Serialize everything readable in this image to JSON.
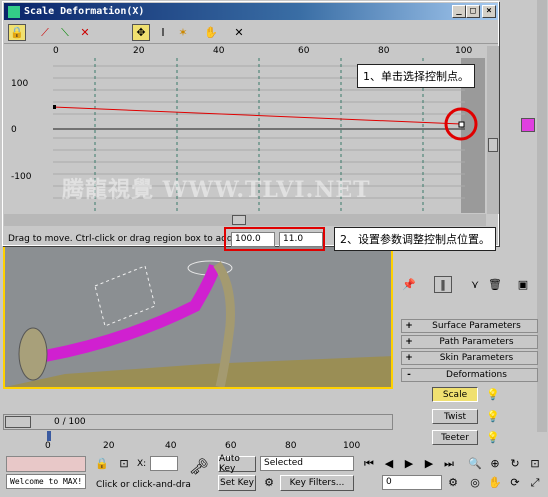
{
  "window": {
    "title": "Scale Deformation(X)"
  },
  "toolbar": {
    "icons": [
      "lock-icon",
      "curve-icon",
      "curve-icon",
      "curve-icon",
      "move-icon",
      "scale-icon",
      "insert-icon",
      "hand-icon",
      "delete-icon"
    ]
  },
  "ruler": {
    "ticks": [
      "0",
      "20",
      "40",
      "60",
      "80",
      "100"
    ]
  },
  "yaxis": {
    "ticks": [
      "100",
      "0",
      "-100"
    ]
  },
  "status": {
    "hint": "Drag to move. Ctrl-click or drag region box to add to",
    "x_value": "100.0",
    "y_value": "11.0"
  },
  "callouts": {
    "c1": "1、单击选择控制点。",
    "c2": "2、设置参数调整控制点位置。"
  },
  "watermark": "腾龍視覺 WWW.TLVI.NET",
  "rollouts": [
    {
      "sign": "+",
      "label": "Surface Parameters"
    },
    {
      "sign": "+",
      "label": "Path Parameters"
    },
    {
      "sign": "+",
      "label": "Skin Parameters"
    },
    {
      "sign": "-",
      "label": "Deformations"
    }
  ],
  "deform_buttons": [
    "Scale",
    "Twist",
    "Teeter"
  ],
  "timeline": {
    "frame": "0 / 100",
    "ticks": [
      "0",
      "20",
      "40",
      "60",
      "80",
      "100"
    ]
  },
  "bottom": {
    "maxscript": "Welcome to MAX!",
    "prompt": "Click or click-and-dra",
    "x_label": "X:",
    "autokey": "Auto Key",
    "setkey": "Set Key",
    "selected": "Selected",
    "keyfilters": "Key Filters...",
    "frame_field": "0"
  },
  "colors": {
    "yellow_border": "#ffd100",
    "red": "#e00000",
    "magenta": "#c020c0"
  }
}
